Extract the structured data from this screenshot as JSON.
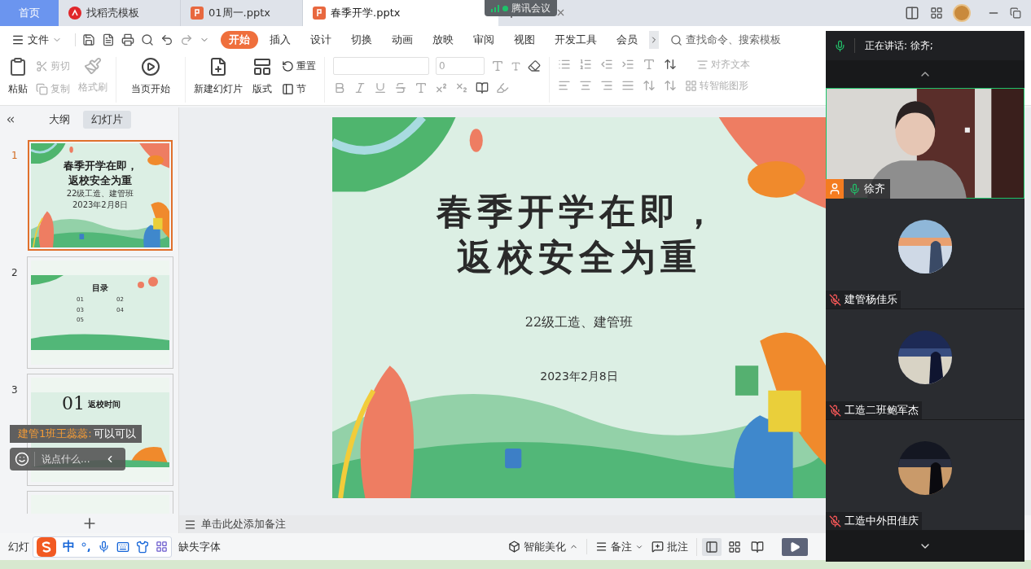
{
  "tabs": [
    {
      "label": "首页",
      "kind": "home",
      "selected": false
    },
    {
      "label": "找稻壳模板",
      "kind": "docer",
      "selected": false
    },
    {
      "label": "01周一.pptx",
      "kind": "pptx",
      "selected": false
    },
    {
      "label": "春季开学.pptx",
      "kind": "pptx",
      "selected": true
    }
  ],
  "meeting_badge": {
    "label": "腾讯会议"
  },
  "menu": {
    "file": "文件",
    "tabs": [
      {
        "label": "开始",
        "selected": true
      },
      {
        "label": "插入",
        "selected": false
      },
      {
        "label": "设计",
        "selected": false
      },
      {
        "label": "切换",
        "selected": false
      },
      {
        "label": "动画",
        "selected": false
      },
      {
        "label": "放映",
        "selected": false
      },
      {
        "label": "审阅",
        "selected": false
      },
      {
        "label": "视图",
        "selected": false
      },
      {
        "label": "开发工具",
        "selected": false
      },
      {
        "label": "会员",
        "selected": false
      }
    ],
    "search": {
      "placeholder": "查找命令、搜索模板"
    }
  },
  "ribbon": {
    "paste": "粘贴",
    "cut": {
      "label": "剪切",
      "disabled": true
    },
    "copy": {
      "label": "复制",
      "disabled": true
    },
    "format_painter": {
      "label": "格式刷",
      "disabled": true
    },
    "play_from_current": "当页开始",
    "new_slide": "新建幻灯片",
    "layout": "版式",
    "reset": "重置",
    "section": "节",
    "font_size": {
      "value": "0"
    },
    "align_text": {
      "label": "对齐文本",
      "disabled": true
    },
    "smartart": {
      "label": "转智能图形",
      "disabled": true
    }
  },
  "left_panel": {
    "view_tabs": [
      {
        "label": "大纲",
        "selected": false
      },
      {
        "label": "幻灯片",
        "selected": true
      }
    ],
    "slides": [
      {
        "number": "1",
        "selected": true,
        "kind": "title",
        "title_lines": [
          "春季开学在即，",
          "返校安全为重"
        ],
        "subtitle": "22级工造、建管班",
        "date": "2023年2月8日"
      },
      {
        "number": "2",
        "selected": false,
        "kind": "contents",
        "heading": "目录",
        "items": [
          "01",
          "02",
          "03",
          "04",
          "05"
        ]
      },
      {
        "number": "3",
        "selected": false,
        "kind": "section",
        "section_number": "01",
        "heading": "返校时间"
      },
      {
        "selected": false,
        "kind": "blank"
      }
    ]
  },
  "slide": {
    "title_lines": [
      "春季开学在即，",
      "返校安全为重"
    ],
    "subtitle": "22级工造、建管班",
    "date": "2023年2月8日"
  },
  "notes": {
    "placeholder": "单击此处添加备注"
  },
  "chat": {
    "sender": "建管1班王蕊蕊:",
    "message": "可以可以",
    "input": {
      "placeholder": "说点什么..."
    }
  },
  "meeting": {
    "speaking": "正在讲话: 徐齐;",
    "speaker": {
      "name": "徐齐",
      "muted": false
    },
    "participants": [
      {
        "name": "建管杨佳乐",
        "muted": true
      },
      {
        "name": "工造二班鲍军杰",
        "muted": true
      },
      {
        "name": "工造中外田佳庆",
        "muted": true
      }
    ]
  },
  "status_bar": {
    "left": "幻灯",
    "ime": {
      "mode": "中"
    },
    "missing_fonts": "缺失字体",
    "beautify": "智能美化",
    "notes": "备注",
    "comments": "批注",
    "views": [
      {
        "selected": true
      },
      {
        "selected": false
      },
      {
        "selected": false
      }
    ]
  }
}
